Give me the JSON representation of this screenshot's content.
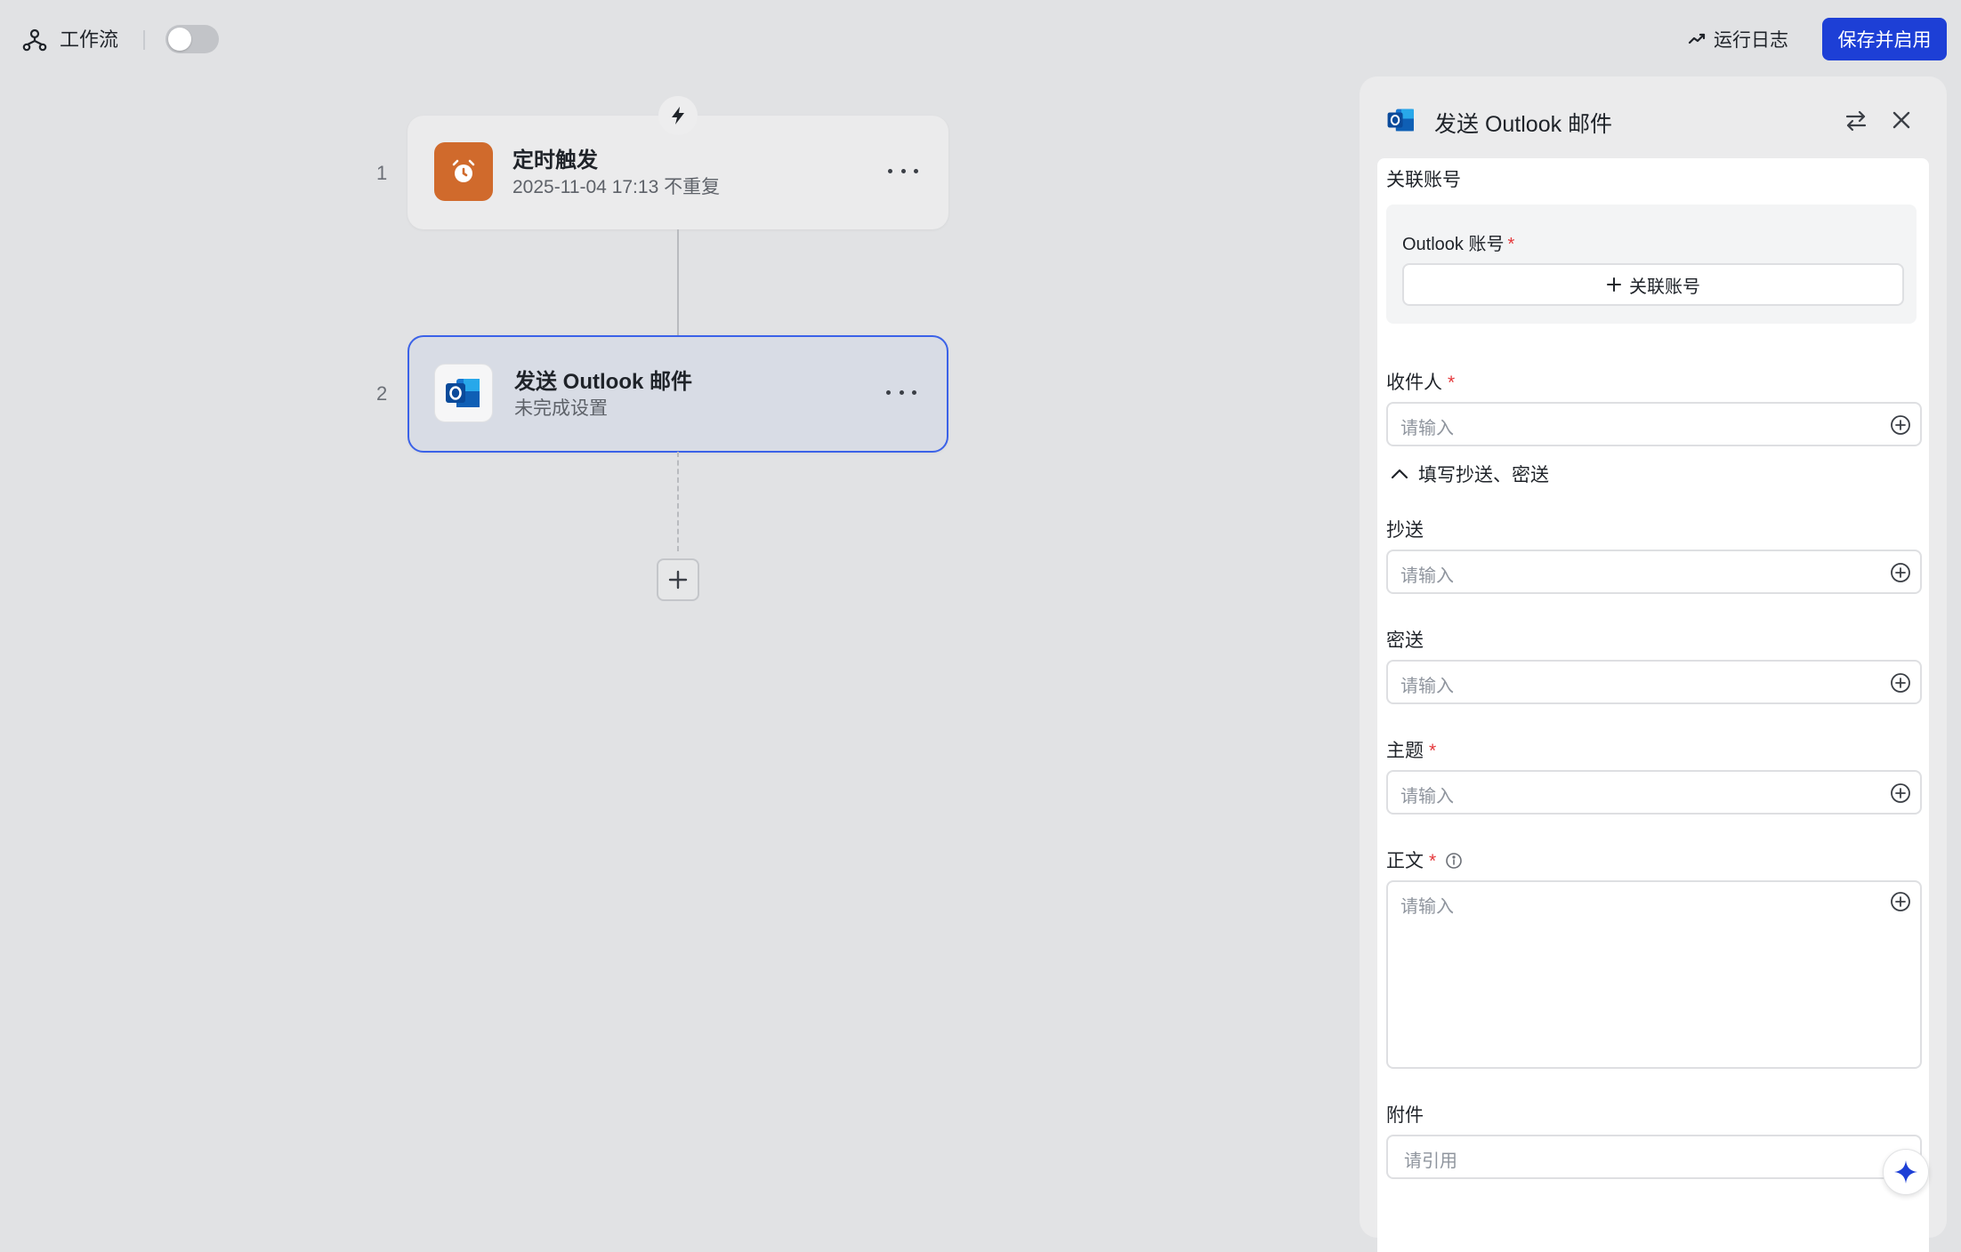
{
  "topbar": {
    "title": "工作流",
    "toggle_enabled": false,
    "log_label": "运行日志",
    "save_label": "保存并启用"
  },
  "flow": {
    "steps": [
      {
        "num": "1",
        "title": "定时触发",
        "subtitle": "2025-11-04 17:13 不重复",
        "icon": "alarm-clock-icon"
      },
      {
        "num": "2",
        "title": "发送 Outlook 邮件",
        "subtitle": "未完成设置",
        "icon": "outlook-icon"
      }
    ]
  },
  "panel": {
    "title": "发送 Outlook 邮件",
    "account_section": "关联账号",
    "account_label": "Outlook 账号",
    "account_button": "关联账号",
    "to_label": "收件人",
    "to_placeholder": "请输入",
    "cc_toggle": "填写抄送、密送",
    "cc_label": "抄送",
    "cc_placeholder": "请输入",
    "bcc_label": "密送",
    "bcc_placeholder": "请输入",
    "subject_label": "主题",
    "subject_placeholder": "请输入",
    "body_label": "正文",
    "body_placeholder": "请输入",
    "attach_label": "附件",
    "attach_placeholder": "请引用",
    "required_mark": "*"
  },
  "colors": {
    "primary": "#1d3fd6",
    "trigger_orange": "#d06a2c",
    "required_red": "#e5383b",
    "active_border": "#3b62e8"
  }
}
